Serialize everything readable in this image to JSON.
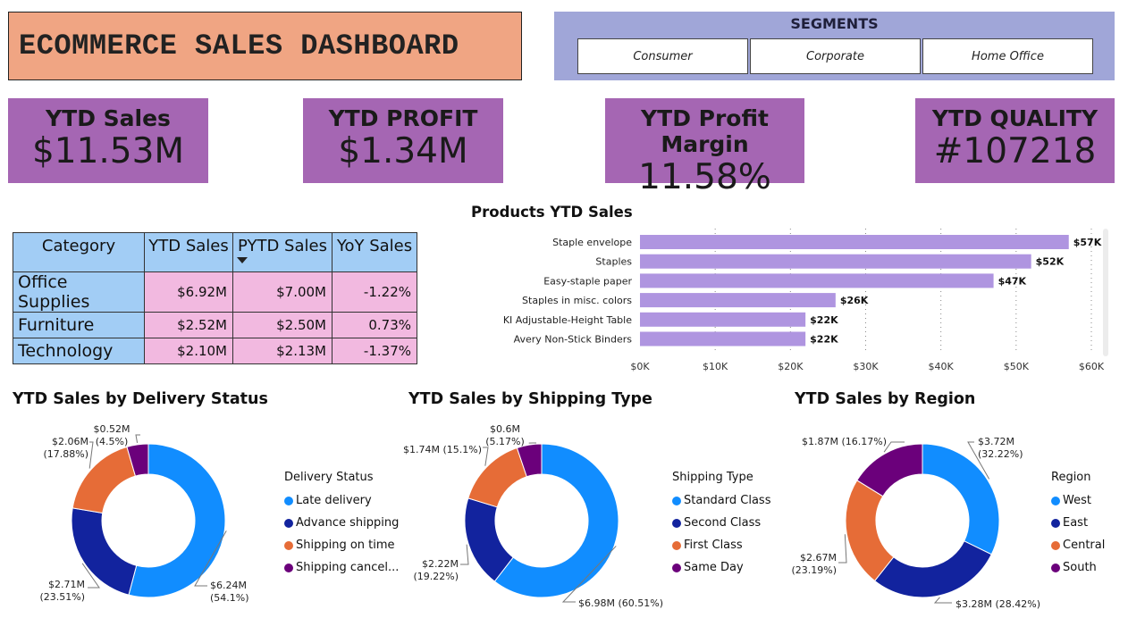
{
  "header": {
    "title": "ECOMMERCE SALES DASHBOARD"
  },
  "segments": {
    "title": "SEGMENTS",
    "options": [
      "Consumer",
      "Corporate",
      "Home Office"
    ]
  },
  "kpis": [
    {
      "label": "YTD Sales",
      "value": "$11.53M"
    },
    {
      "label": "YTD PROFIT",
      "value": "$1.34M"
    },
    {
      "label": "YTD Profit Margin",
      "value": "11.58%"
    },
    {
      "label": "YTD QUALITY",
      "value": "#107218"
    }
  ],
  "category_table": {
    "headers": [
      "Category",
      "YTD Sales",
      "PYTD Sales",
      "YoY Sales"
    ],
    "rows": [
      {
        "category": "Office Supplies",
        "ytd": "$6.92M",
        "pytd": "$7.00M",
        "yoy": "-1.22%"
      },
      {
        "category": "Furniture",
        "ytd": "$2.52M",
        "pytd": "$2.50M",
        "yoy": "0.73%"
      },
      {
        "category": "Technology",
        "ytd": "$2.10M",
        "pytd": "$2.13M",
        "yoy": "-1.37%"
      }
    ]
  },
  "chart_data": [
    {
      "type": "bar",
      "orientation": "horizontal",
      "title": "Products YTD Sales",
      "categories": [
        "Staple envelope",
        "Staples",
        "Easy-staple paper",
        "Staples in misc. colors",
        "KI Adjustable-Height Table",
        "Avery Non-Stick Binders"
      ],
      "values": [
        57,
        52,
        47,
        26,
        22,
        22
      ],
      "data_labels": [
        "$57K",
        "$52K",
        "$47K",
        "$26K",
        "$22K",
        "$22K"
      ],
      "x_ticks": [
        "$0K",
        "$10K",
        "$20K",
        "$30K",
        "$40K",
        "$50K",
        "$60K"
      ],
      "xlim": [
        0,
        60
      ],
      "grid": true,
      "color": "#af95e0"
    },
    {
      "type": "pie",
      "style": "donut",
      "title": "YTD Sales by Delivery Status",
      "legend_title": "Delivery Status",
      "legend_placement": "right",
      "labels": [
        "Late delivery",
        "Advance shipping",
        "Shipping on time",
        "Shipping cancel..."
      ],
      "values": [
        6.24,
        2.71,
        2.06,
        0.52
      ],
      "percent": [
        54.1,
        23.51,
        17.88,
        4.5
      ],
      "data_labels": [
        [
          "$6.24M",
          "(54.1%)"
        ],
        [
          "$2.71M",
          "(23.51%)"
        ],
        [
          "$2.06M",
          "(17.88%)"
        ],
        [
          "$0.52M",
          "(4.5%)"
        ]
      ],
      "colors": [
        "#118dff",
        "#12239e",
        "#e66c37",
        "#6b007b"
      ]
    },
    {
      "type": "pie",
      "style": "donut",
      "title": "YTD Sales by Shipping Type",
      "legend_title": "Shipping Type",
      "legend_placement": "right",
      "labels": [
        "Standard Class",
        "Second Class",
        "First Class",
        "Same Day"
      ],
      "values": [
        6.98,
        2.22,
        1.74,
        0.6
      ],
      "percent": [
        60.51,
        19.22,
        15.1,
        5.17
      ],
      "data_labels": [
        [
          "$6.98M (60.51%)"
        ],
        [
          "$2.22M",
          "(19.22%)"
        ],
        [
          "$1.74M (15.1%)"
        ],
        [
          "$0.6M",
          "(5.17%)"
        ]
      ],
      "colors": [
        "#118dff",
        "#12239e",
        "#e66c37",
        "#6b007b"
      ]
    },
    {
      "type": "pie",
      "style": "donut",
      "title": "YTD Sales by Region",
      "legend_title": "Region",
      "legend_placement": "right",
      "labels": [
        "West",
        "East",
        "Central",
        "South"
      ],
      "values": [
        3.72,
        3.28,
        2.67,
        1.87
      ],
      "percent": [
        32.22,
        28.42,
        23.19,
        16.17
      ],
      "data_labels": [
        [
          "$3.72M",
          "(32.22%)"
        ],
        [
          "$3.28M (28.42%)"
        ],
        [
          "$2.67M",
          "(23.19%)"
        ],
        [
          "$1.87M (16.17%)"
        ]
      ],
      "colors": [
        "#118dff",
        "#12239e",
        "#e66c37",
        "#6b007b"
      ]
    }
  ]
}
